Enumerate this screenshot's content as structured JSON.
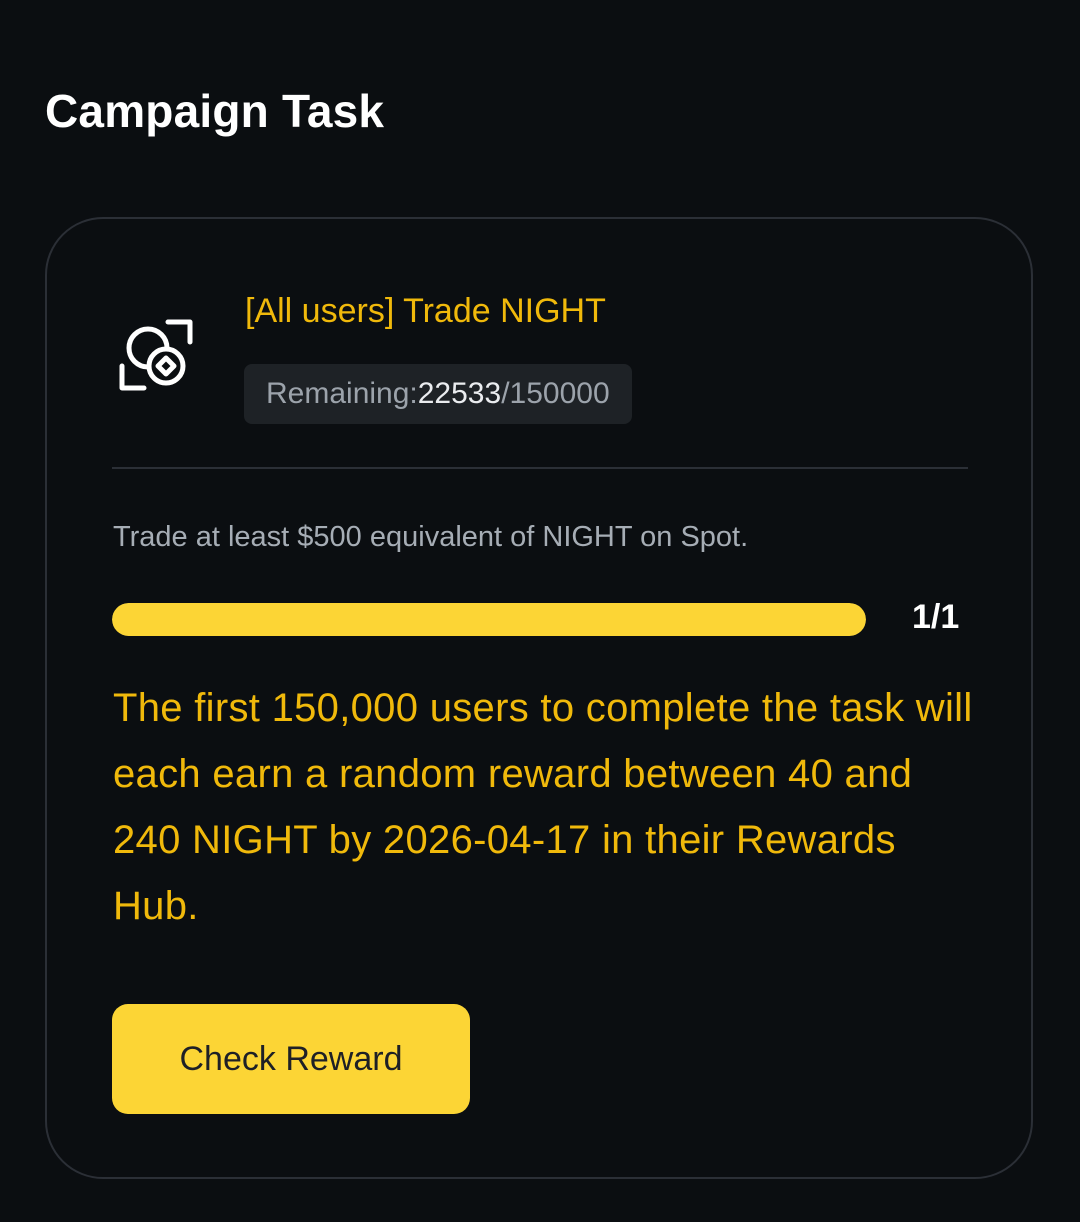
{
  "section": {
    "title": "Campaign Task"
  },
  "task": {
    "icon": "scan-coin-icon",
    "title": "[All users] Trade NIGHT",
    "remaining": {
      "label": "Remaining: ",
      "current": "22533",
      "separator_total": "/150000"
    },
    "description": "Trade at least $500 equivalent of NIGHT on Spot.",
    "progress": {
      "fraction": 1.0,
      "text": "1/1"
    },
    "reward_text": "The first 150,000 users to complete the task will each earn a random reward between 40 and 240 NIGHT by 2026-04-17 in their Rewards Hub.",
    "button_label": "Check Reward"
  },
  "colors": {
    "background": "#0b0e11",
    "accent_text": "#f0b90b",
    "button_yellow": "#fcd535",
    "card_border": "#2b2f36"
  }
}
